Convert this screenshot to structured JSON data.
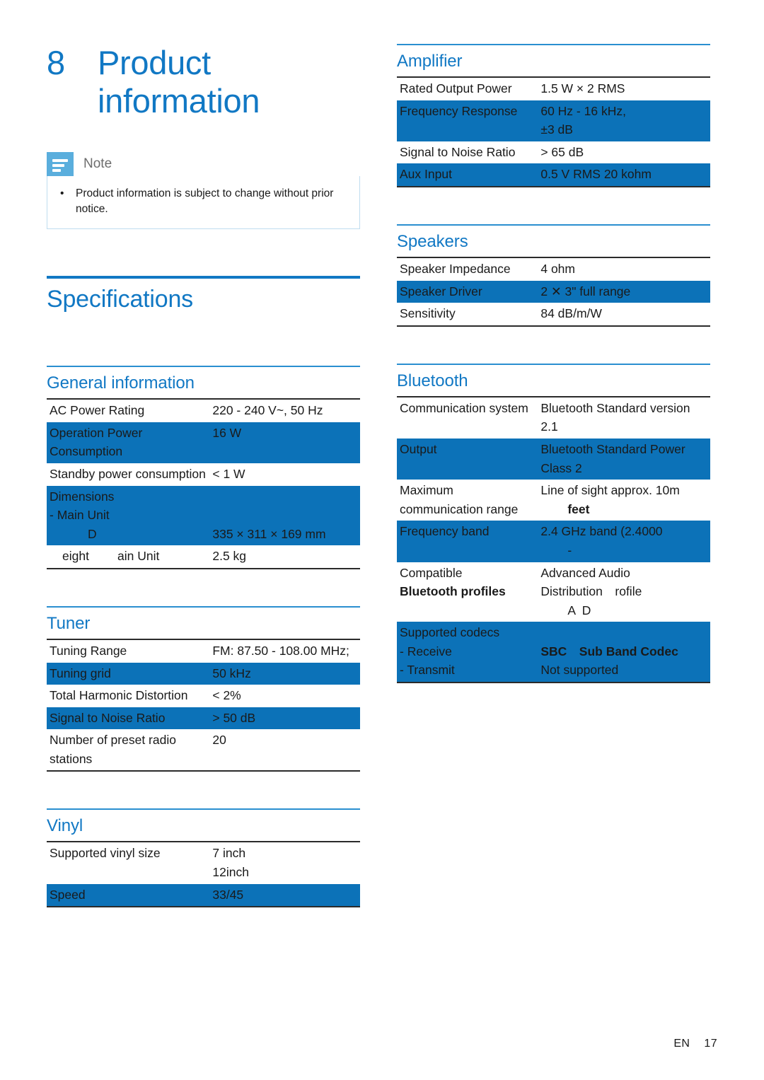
{
  "chapter": {
    "number": "8",
    "title": "Product information"
  },
  "note": {
    "label": "Note",
    "bullet": "•",
    "items": [
      "Product information is subject to change without prior notice."
    ]
  },
  "specifications": {
    "heading": "Specifications"
  },
  "colors": {
    "accent_blue": "#1178c4",
    "row_highlight": "#0c72b8",
    "note_icon": "#5aaedd",
    "note_border": "#bfdcef"
  },
  "left_column": {
    "blocks": [
      {
        "heading": "General information",
        "rows": [
          {
            "key": "AC Power Rating",
            "value": "220 - 240 V~, 50 Hz",
            "highlight": false
          },
          {
            "key": "Operation Power Consumption",
            "value": "16 W",
            "highlight": true
          },
          {
            "key": "Standby power consumption",
            "value": "< 1 W",
            "highlight": false
          },
          {
            "key": "Dimensions",
            "key_line2": "- Main Unit",
            "key_line3": "D",
            "value_line3": "335 × 311 × 169 mm",
            "highlight": true
          },
          {
            "key": "eight",
            "key_line2_inline": "ain Unit",
            "value": "2.5 kg",
            "highlight": false
          }
        ]
      },
      {
        "heading": "Tuner",
        "rows": [
          {
            "key": "Tuning Range",
            "value": "FM: 87.50 - 108.00 MHz;",
            "highlight": false
          },
          {
            "key": "Tuning grid",
            "value": "50 kHz",
            "highlight": true
          },
          {
            "key": "Total Harmonic Distortion",
            "value": "< 2%",
            "highlight": false
          },
          {
            "key": "Signal to Noise Ratio",
            "value": "> 50 dB",
            "highlight": true
          },
          {
            "key": "Number of preset radio stations",
            "value": "20",
            "highlight": false
          }
        ]
      },
      {
        "heading": "Vinyl",
        "rows": [
          {
            "key": "Supported vinyl size",
            "value": "7 inch",
            "value_line2": "12inch",
            "highlight": false
          },
          {
            "key": "Speed",
            "value": "33/45",
            "highlight": true
          }
        ]
      }
    ]
  },
  "right_column": {
    "blocks": [
      {
        "heading": "Amplifier",
        "rows": [
          {
            "key": "Rated Output Power",
            "value": "1.5 W × 2 RMS",
            "highlight": false
          },
          {
            "key": "Frequency Response",
            "value": "60 Hz - 16 kHz,",
            "value_line2": "±3 dB",
            "highlight": true
          },
          {
            "key": "Signal to Noise Ratio",
            "value": "> 65 dB",
            "highlight": false
          },
          {
            "key": "Aux Input",
            "value": "0.5 V RMS 20 kohm",
            "highlight": true
          }
        ]
      },
      {
        "heading": "Speakers",
        "rows": [
          {
            "key": "Speaker Impedance",
            "value": "4 ohm",
            "highlight": false
          },
          {
            "key": "Speaker Driver",
            "value": "2 ✕ 3\" full range",
            "highlight": true
          },
          {
            "key": "Sensitivity",
            "value": "84 dB/m/W",
            "highlight": false
          }
        ]
      },
      {
        "heading": "Bluetooth",
        "rows": [
          {
            "key": "Communication system",
            "value": "Bluetooth Standard version 2.1",
            "highlight": false
          },
          {
            "key": "Output",
            "value": "Bluetooth Standard Power Class 2",
            "highlight": true
          },
          {
            "key": "Maximum communication range",
            "value": "Line of sight approx. 10m",
            "value_line2": "feet",
            "value_line2_bold": true,
            "highlight": false
          },
          {
            "key": "Frequency band",
            "value": "2.4 GHz band (2.4000",
            "value_line2": "-",
            "highlight": true
          },
          {
            "key": "Compatible",
            "key_line2": "Bluetooth profiles",
            "key_line2_bold": true,
            "value": "Advanced Audio",
            "value_line2": "Distribution rofile",
            "value_line3": "A D",
            "highlight": false
          },
          {
            "key": "Supported codecs",
            "key_line2": "- Receive",
            "key_line3": "- Transmit",
            "value_line2": "SBC Sub Band Codec",
            "value_line2_bold": true,
            "value_line3": "Not supported",
            "highlight": true
          }
        ]
      }
    ]
  },
  "footer": {
    "language": "EN",
    "page": "17"
  }
}
